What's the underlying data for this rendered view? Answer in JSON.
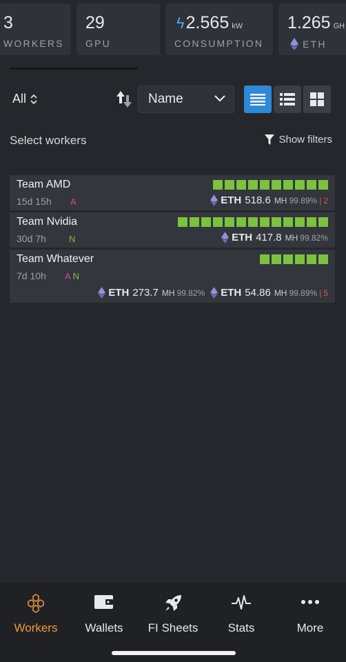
{
  "stats": [
    {
      "value": "3",
      "unit": "",
      "label": "WORKERS"
    },
    {
      "value": "29",
      "unit": "",
      "label": "GPU"
    },
    {
      "value": "2.565",
      "unit": "kW",
      "label": "CONSUMPTION"
    },
    {
      "value": "1.265",
      "unit": "GH",
      "label": "ETH"
    }
  ],
  "toolbar": {
    "filter_label": "All",
    "sort_select_value": "Name",
    "select_workers_label": "Select workers",
    "show_filters_label": "Show filters"
  },
  "workers": [
    {
      "name": "Team AMD",
      "uptime": "15d 15h",
      "tag_a": "A",
      "tag_n": "",
      "gpu_count": 10,
      "hashrates": [
        {
          "coin": "ETH",
          "value": "518.6",
          "unit": "MH",
          "efficiency": "99.89%",
          "sep": "|",
          "invalid": "2"
        }
      ]
    },
    {
      "name": "Team Nvidia",
      "uptime": "30d 7h",
      "tag_a": "",
      "tag_n": "N",
      "gpu_count": 13,
      "hashrates": [
        {
          "coin": "ETH",
          "value": "417.8",
          "unit": "MH",
          "efficiency": "99.82%",
          "sep": "",
          "invalid": ""
        }
      ]
    },
    {
      "name": "Team Whatever",
      "uptime": "7d 10h",
      "tag_a": "A",
      "tag_n": "N",
      "gpu_count": 6,
      "hashrates": [
        {
          "coin": "ETH",
          "value": "273.7",
          "unit": "MH",
          "efficiency": "99.82%",
          "sep": "",
          "invalid": ""
        },
        {
          "coin": "ETH",
          "value": "54.86",
          "unit": "MH",
          "efficiency": "99.89%",
          "sep": "|",
          "invalid": "5"
        }
      ]
    }
  ],
  "nav": [
    {
      "label": "Workers",
      "icon": "honeycomb-icon",
      "active": true
    },
    {
      "label": "Wallets",
      "icon": "wallet-icon",
      "active": false
    },
    {
      "label": "FI Sheets",
      "icon": "rocket-icon",
      "active": false
    },
    {
      "label": "Stats",
      "icon": "pulse-icon",
      "active": false
    },
    {
      "label": "More",
      "icon": "more-dots-icon",
      "active": false
    }
  ],
  "colors": {
    "background": "#25272c",
    "card": "#33363c",
    "gpu_ok": "#7cc23f",
    "accent_blue": "#2f88d8",
    "active_nav": "#f09a3e",
    "tag_amd": "#d8489a",
    "tag_nvidia": "#7fbf3a",
    "invalid": "#e05555"
  }
}
